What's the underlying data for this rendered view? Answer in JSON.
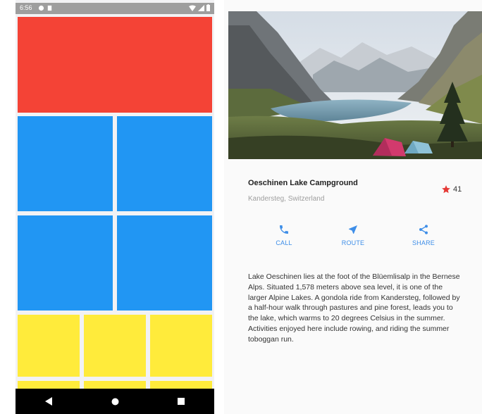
{
  "status_bar": {
    "time": "6:56"
  },
  "layout_demo": {
    "colors": {
      "red": "#f44336",
      "blue": "#2196f3",
      "yellow": "#ffeb3b"
    }
  },
  "navigation": {
    "back_icon": "back-triangle-icon",
    "home_icon": "home-circle-icon",
    "recents_icon": "recents-square-icon"
  },
  "campground": {
    "title": "Oeschinen Lake Campground",
    "location": "Kandersteg, Switzerland",
    "rating": "41",
    "accent_color": "#3e8ee8",
    "star_color": "#e53935",
    "actions": [
      {
        "label": "CALL",
        "icon": "phone-icon"
      },
      {
        "label": "ROUTE",
        "icon": "navigation-arrow-icon"
      },
      {
        "label": "SHARE",
        "icon": "share-icon"
      }
    ],
    "description": "Lake Oeschinen lies at the foot of the Blüemlisalp in the Bernese Alps. Situated 1,578 meters above sea level, it is one of the larger Alpine Lakes. A gondola ride from Kandersteg, followed by a half-hour walk through pastures and pine forest, leads you to the lake, which warms to 20 degrees Celsius in the summer. Activities enjoyed here include rowing, and riding the summer toboggan run."
  }
}
